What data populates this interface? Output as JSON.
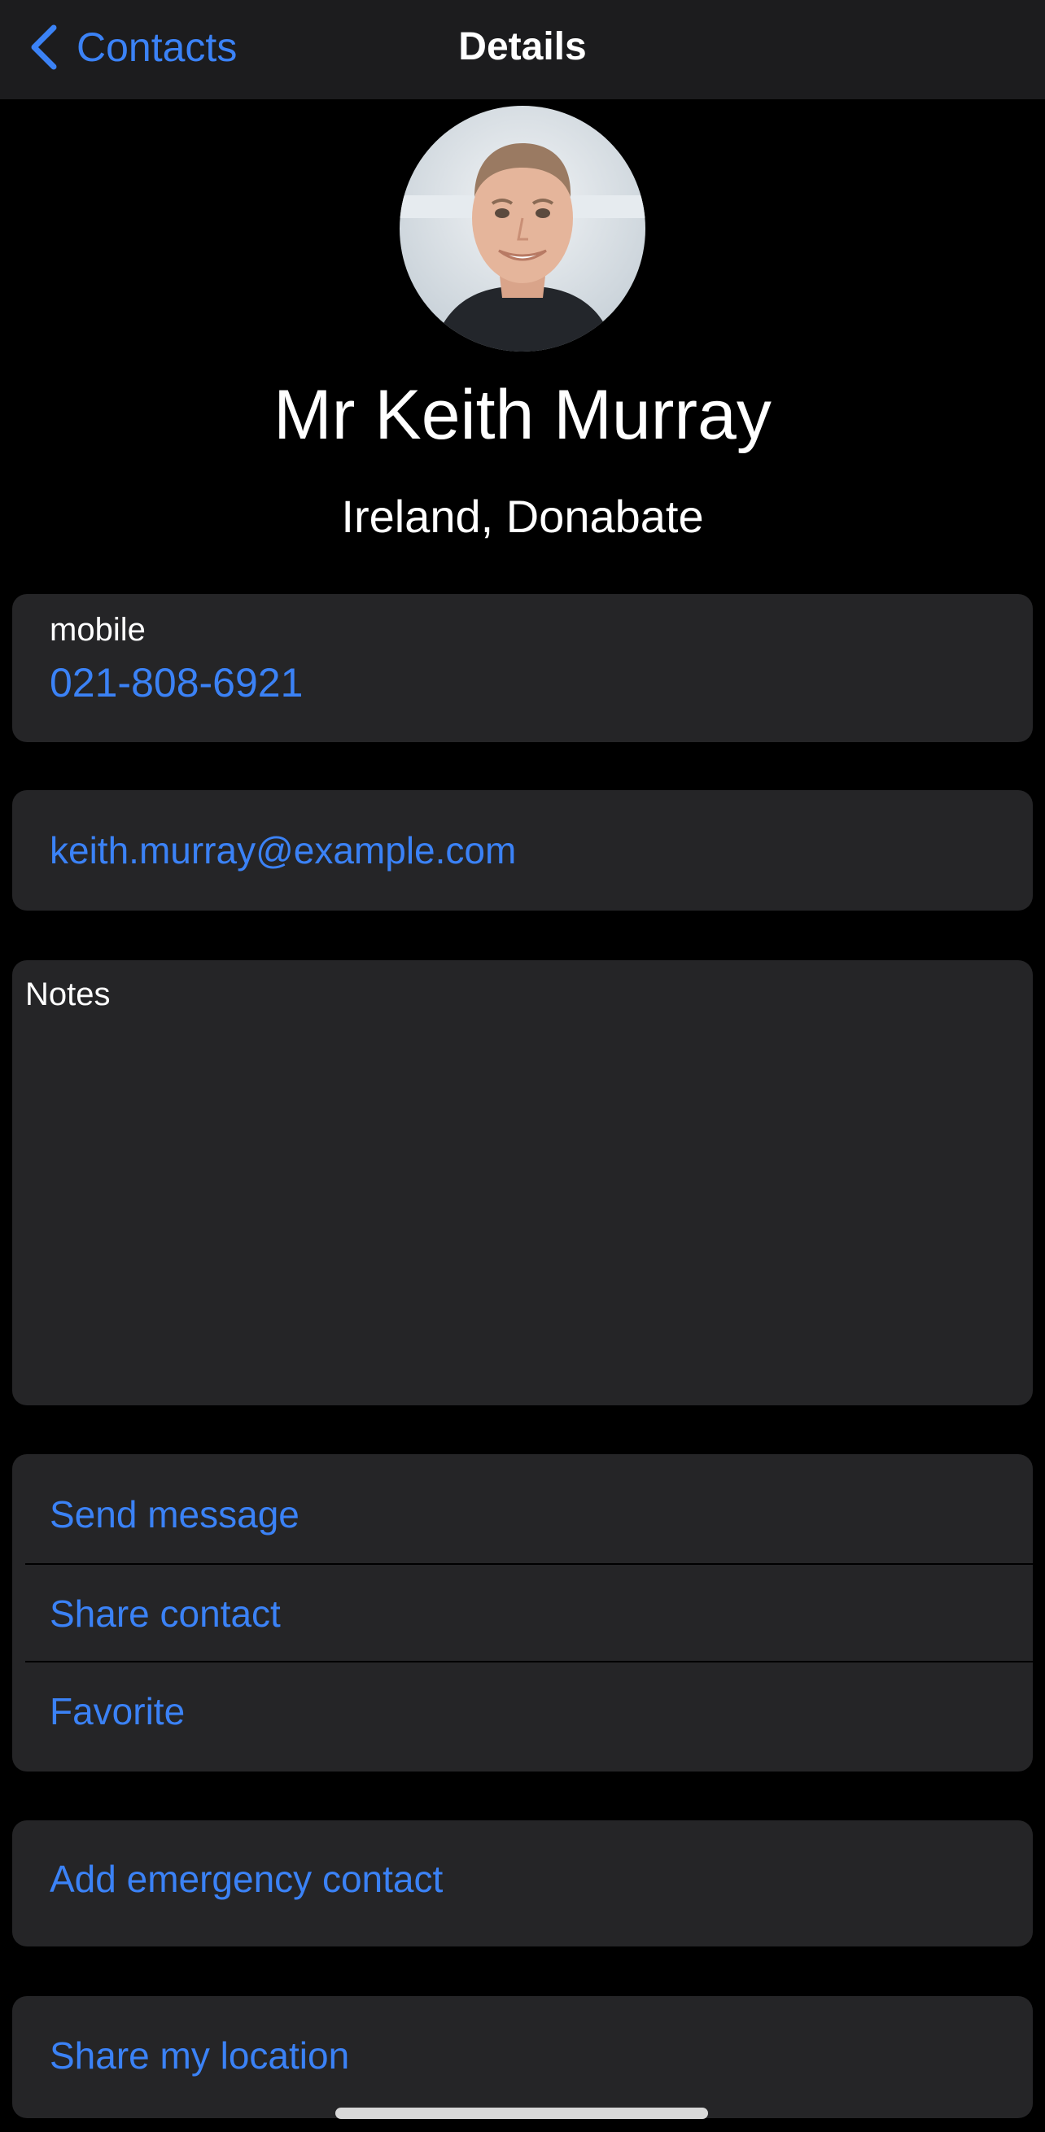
{
  "navbar": {
    "back_label": "Contacts",
    "title": "Details"
  },
  "contact": {
    "name": "Mr Keith Murray",
    "location": "Ireland, Donabate",
    "avatar_icon": "person-photo"
  },
  "phone": {
    "label": "mobile",
    "value": "021-808-6921"
  },
  "email": {
    "value": "keith.murray@example.com"
  },
  "notes": {
    "label": "Notes",
    "value": ""
  },
  "actions": [
    {
      "label": "Send message"
    },
    {
      "label": "Share contact"
    },
    {
      "label": "Favorite"
    }
  ],
  "emergency": {
    "label": "Add emergency contact"
  },
  "location_share": {
    "label": "Share my location"
  },
  "colors": {
    "accent": "#3b82f6",
    "background": "#000000",
    "card": "#252527",
    "navbar": "#1c1c1e",
    "text": "#ffffff"
  }
}
